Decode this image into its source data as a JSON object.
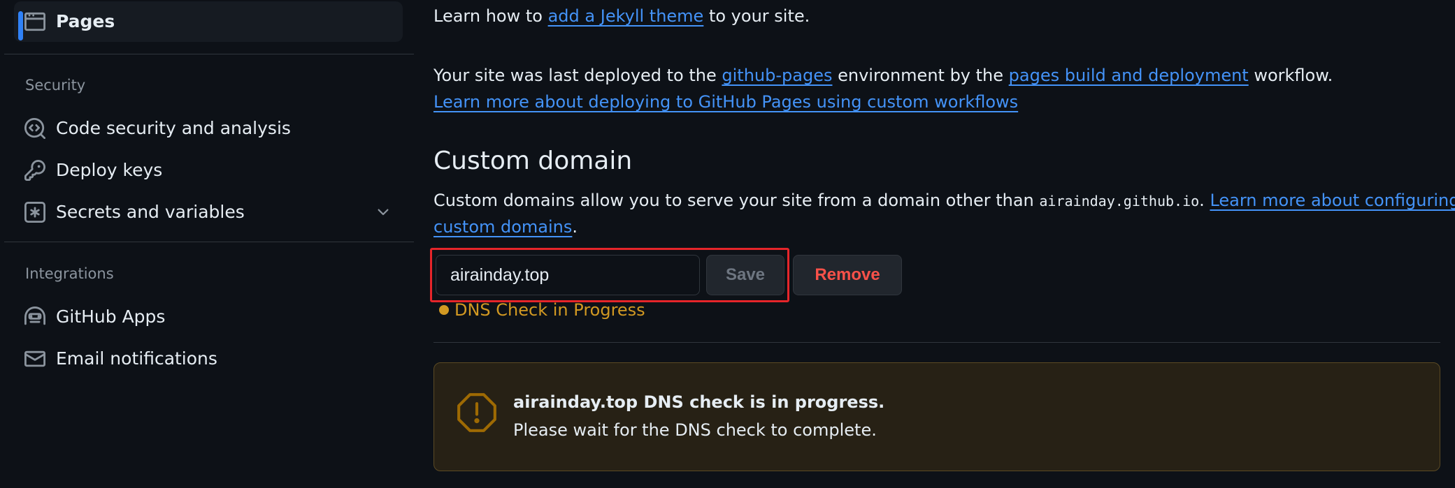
{
  "sidebar": {
    "pages": {
      "label": "Pages",
      "icon": "browser-icon"
    },
    "security_heading": "Security",
    "security_items": [
      {
        "label": "Code security and analysis",
        "icon": "codescan-icon"
      },
      {
        "label": "Deploy keys",
        "icon": "key-icon"
      },
      {
        "label": "Secrets and variables",
        "icon": "key-asterisk-icon"
      }
    ],
    "integrations_heading": "Integrations",
    "integrations_items": [
      {
        "label": "GitHub Apps",
        "icon": "hubot-icon"
      },
      {
        "label": "Email notifications",
        "icon": "mail-icon"
      }
    ]
  },
  "main": {
    "theme_line": {
      "before": "Learn how to ",
      "link": "add a Jekyll theme",
      "after": " to your site."
    },
    "deploy_line": {
      "t1": "Your site was last deployed to the ",
      "env_link": "github-pages",
      "t2": " environment by the ",
      "workflow_link": "pages build and deployment",
      "t3": " workflow."
    },
    "learn_workflows_link": "Learn more about deploying to GitHub Pages using custom workflows",
    "custom_domain": {
      "heading": "Custom domain",
      "desc_before": "Custom domains allow you to serve your site from a domain other than ",
      "default_domain": "airainday.github.io",
      "desc_after": ". ",
      "learn_link_part1": "Learn more about configuring",
      "learn_link_part2": "custom domains",
      "period": ".",
      "input_value": "airainday.top",
      "save_label": "Save",
      "remove_label": "Remove",
      "status": "DNS Check in Progress"
    },
    "flash": {
      "title": "airainday.top DNS check is in progress.",
      "body": "Please wait for the DNS check to complete."
    }
  },
  "colors": {
    "background": "#0d1117",
    "link": "#4493f8",
    "accent": "#2f81f7",
    "warning": "#d29922",
    "danger": "#f85149",
    "highlight": "#e5252a"
  }
}
